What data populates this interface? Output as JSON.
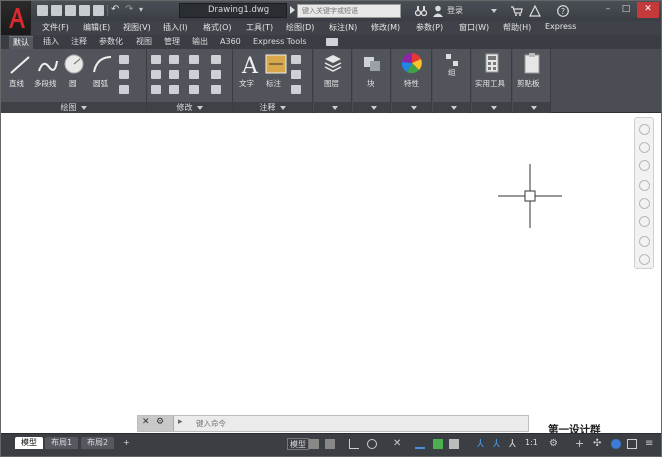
{
  "title_bar": {
    "filename": "Drawing1.dwg",
    "search_placeholder": "键入关键字或短语",
    "login_label": "登录",
    "window_controls": [
      "minimize",
      "maximize",
      "close"
    ]
  },
  "menu": {
    "items": [
      "文件(F)",
      "编辑(E)",
      "视图(V)",
      "插入(I)",
      "格式(O)",
      "工具(T)",
      "绘图(D)",
      "标注(N)",
      "修改(M)",
      "参数(P)",
      "窗口(W)",
      "帮助(H)",
      "Express"
    ]
  },
  "ribbon_tabs": {
    "items": [
      "默认",
      "插入",
      "注释",
      "参数化",
      "视图",
      "管理",
      "输出",
      "A360",
      "Express Tools"
    ],
    "active": "默认"
  },
  "ribbon": {
    "draw": {
      "footer": "绘图",
      "tools": [
        "直线",
        "多段线",
        "圆",
        "圆弧"
      ]
    },
    "modify": {
      "footer": "修改"
    },
    "annotate": {
      "footer": "注释",
      "tools": [
        "文字",
        "标注"
      ]
    },
    "layers": {
      "label": "图层"
    },
    "block": {
      "label": "块"
    },
    "properties": {
      "label": "特性"
    },
    "groups": {
      "label": "组"
    },
    "utilities": {
      "label": "实用工具"
    },
    "clipboard": {
      "label": "剪贴板"
    }
  },
  "command_line": {
    "placeholder": "键入命令"
  },
  "status_bar": {
    "layout_tabs": [
      "模型",
      "布局1",
      "布局2"
    ],
    "add_tab": "+",
    "model_label": "模型",
    "scale": "1:1"
  },
  "watermark": "第一设计群",
  "colors": {
    "titlebar": "#3a3e44",
    "ribbon": "#4a4e54",
    "canvas": "#ffffff",
    "accent_red": "#c4393a"
  }
}
